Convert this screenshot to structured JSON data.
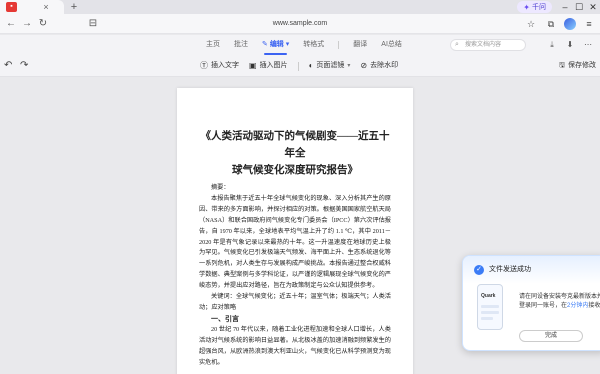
{
  "browser": {
    "tab_close": "×",
    "new_tab": "+",
    "url": "www.sample.com",
    "assistant_label": "千问"
  },
  "menu": {
    "tabs": [
      "主页",
      "批注",
      "编辑",
      "转格式",
      "翻译",
      "AI总结"
    ],
    "active_tab": "编辑",
    "search_placeholder": "搜索文档内容"
  },
  "toolbar": {
    "insert_text": "插入文字",
    "insert_image": "插入图片",
    "page_filter": "页面滤镜",
    "remove_watermark": "去除水印",
    "save_changes": "保存修改"
  },
  "document": {
    "title_line1": "《人类活动驱动下的气候剧变——近五十年全",
    "title_line2": "球气候变化深度研究报告》",
    "abstract_label": "摘要：",
    "abstract": "本报告聚焦于近五十年全球气候变化的现象、深入分析其产生的原因、带来的多方面影响，并探讨相应的对策。根据美国国家航空航天局（NASA）和联合国政府间气候变化专门委员会（IPCC）第六次评估报告，自 1970 年以来，全球地表平均气温上升了约 1.1 ℃，其中 2011－2020 年是有气象记录以来最热的十年。这一升温速度在地球历史上极为罕见。气候变化已引发极端天气频发、海平面上升、生态系统退化等一系列危机，对人类生存与发展构成严峻挑战。本报告通过整合权威科学数据、典型案例与多学科论证，以严谨的逻辑展现全球气候变化的严峻态势，并提出应对路径，旨在为政策制定与公众认知提供参考。",
    "keywords": "关键词：全球气候变化；近五十年；温室气体；极端天气；人类活动；应对策略",
    "section1": "一、引言",
    "intro": "20 世纪 70 年代以来，随着工业化进程加速和全球人口增长，人类活动对气候系统的影响日益显著。从北极冰盖的加速消融到频繁发生的超强台风，从欧洲热浪到澳大利亚山火，气候变化已从科学预测变为现实危机。"
  },
  "popup": {
    "title": "文件发送成功",
    "phone_brand": "Quark",
    "desc_pre": "请在同设备安装夸克最新版本并登录同一账号，在",
    "desc_highlight": "2分钟内",
    "desc_post": "接收",
    "ok_button": "完成"
  },
  "colors": {
    "accent": "#3b63f2",
    "popup_accent": "#3b7cf6"
  }
}
